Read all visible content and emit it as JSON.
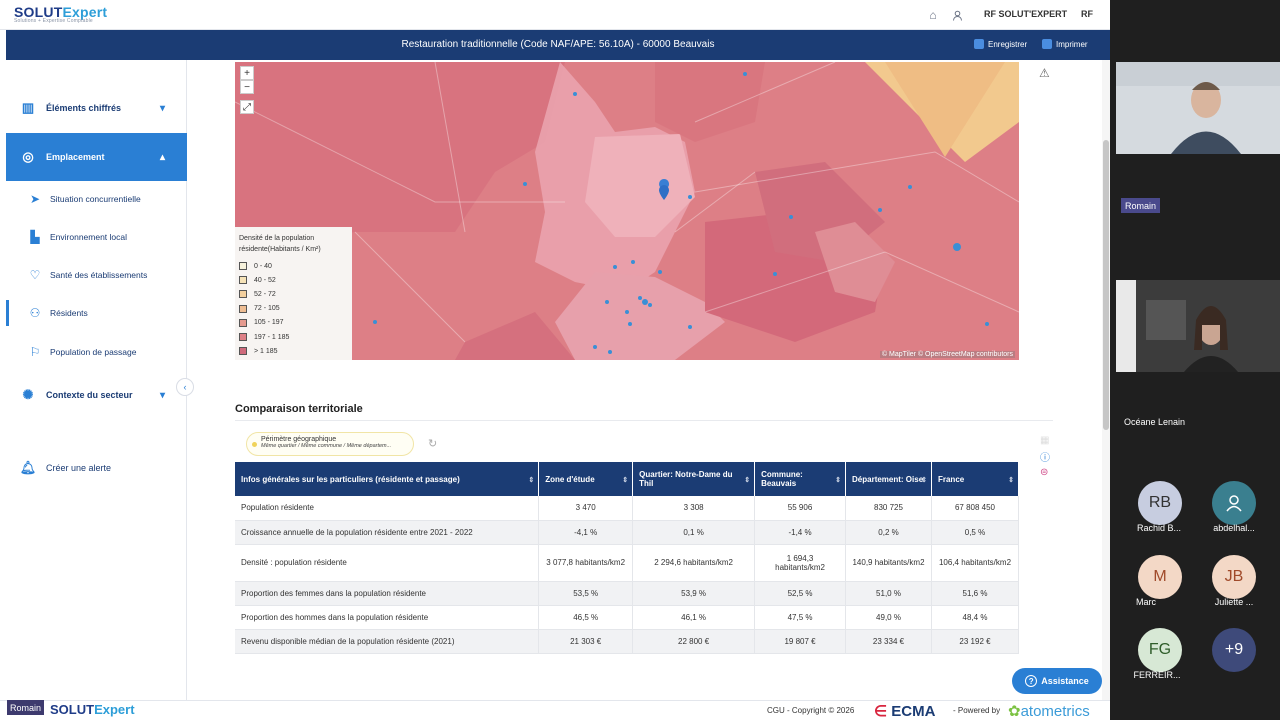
{
  "topbar": {
    "logo_main": "SOLUT",
    "logo_accent": "Expert",
    "logo_tagline": "Solutions + Expertise Comptable",
    "user_label": "RF SOLUT'EXPERT",
    "initials": "RF"
  },
  "titlebar": {
    "title": "Restauration traditionnelle (Code NAF/APE: 56.10A) - 60000 Beauvais",
    "save_label": "Enregistrer",
    "print_label": "Imprimer"
  },
  "sidebar": {
    "elements_chiffres": "Éléments chiffrés",
    "emplacement": "Emplacement",
    "sub_items": [
      "Situation concurrentielle",
      "Environnement local",
      "Santé des établissements",
      "Résidents",
      "Population de passage"
    ],
    "contexte": "Contexte du secteur",
    "alerte": "Créer une alerte"
  },
  "map": {
    "zoom_in": "+",
    "zoom_out": "−",
    "fullscreen": "⤢",
    "legend_title": "Densité de la population résidente(Habitants / Km²)",
    "legend_items": [
      {
        "label": "0 - 40",
        "color": "#f7f2dc"
      },
      {
        "label": "40 - 52",
        "color": "#f6e3b8"
      },
      {
        "label": "52 - 72",
        "color": "#f2cf9e"
      },
      {
        "label": "72 - 105",
        "color": "#eebd93"
      },
      {
        "label": "105 - 197",
        "color": "#e59a8f"
      },
      {
        "label": "197 - 1 185",
        "color": "#dd7f86"
      },
      {
        "label": "> 1 185",
        "color": "#cf6a7c"
      }
    ],
    "attribution": "© MapTiler © OpenStreetMap contributors"
  },
  "comparison": {
    "title": "Comparaison territoriale",
    "perimeter_title": "Périmètre géographique",
    "perimeter_sub": "Même quartier / Même commune / Même départem..."
  },
  "table": {
    "headers": [
      "Infos générales sur les particuliers (résidente et passage)",
      "Zone d'étude",
      "Quartier: Notre-Dame du Thil",
      "Commune: Beauvais",
      "Département: Oise",
      "France"
    ],
    "rows": [
      [
        "Population résidente",
        "3 470",
        "3 308",
        "55 906",
        "830 725",
        "67 808 450"
      ],
      [
        "Croissance annuelle de la population résidente entre 2021 - 2022",
        "-4,1 %",
        "0,1 %",
        "-1,4 %",
        "0,2 %",
        "0,5 %"
      ],
      [
        "Densité : population résidente",
        "3 077,8 habitants/km2",
        "2 294,6 habitants/km2",
        "1 694,3 habitants/km2",
        "140,9 habitants/km2",
        "106,4 habitants/km2"
      ],
      [
        "Proportion des femmes dans la population résidente",
        "53,5 %",
        "53,9 %",
        "52,5 %",
        "51,0 %",
        "51,6 %"
      ],
      [
        "Proportion des hommes dans la population résidente",
        "46,5 %",
        "46,1 %",
        "47,5 %",
        "49,0 %",
        "48,4 %"
      ],
      [
        "Revenu disponible médian de la population résidente (2021)",
        "21 303 €",
        "22 800 €",
        "19 807 €",
        "23 334 €",
        "23 192 €"
      ]
    ]
  },
  "footer": {
    "logo_main": "SOLUT",
    "logo_accent": "Expert",
    "cgu": "CGU  - Copyright © 2026",
    "ecma": "ECMA",
    "powered": "- Powered by",
    "atometrics": "atometrics",
    "assistance": "Assistance",
    "self_name": "Romain"
  },
  "video": {
    "romain": "Romain",
    "oceane": "Océane Lenain",
    "participants": [
      {
        "initials": "RB",
        "name": "Rachid B...",
        "color": "#c7cde0"
      },
      {
        "initials": "",
        "name": "abdelhal...",
        "color": "#3a7f8f"
      },
      {
        "initials": "M",
        "name": "Marc",
        "color": "#f3d8c6"
      },
      {
        "initials": "JB",
        "name": "Juliette ...",
        "color": "#f3d8c6"
      },
      {
        "initials": "FG",
        "name": "FERREIR...",
        "color": "#d7e8d5"
      },
      {
        "initials": "+9",
        "name": "",
        "color": "#3e4a7a"
      }
    ]
  },
  "colors": {
    "navy": "#1b3c74",
    "accent": "#2a7fd4"
  }
}
